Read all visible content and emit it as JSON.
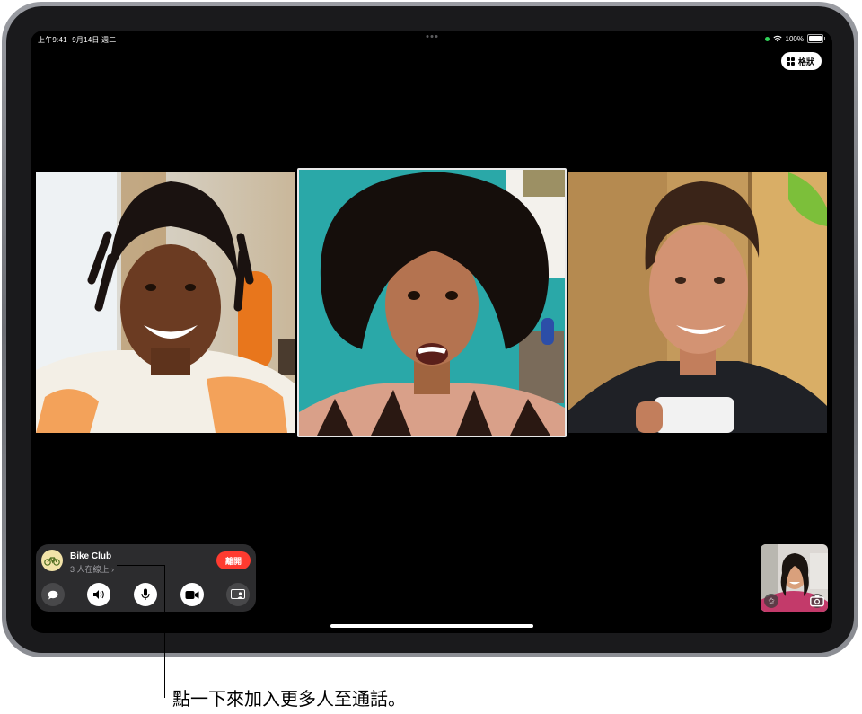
{
  "status_bar": {
    "time": "上午9:41",
    "date": "9月14日 週二",
    "battery": "100%"
  },
  "layout_button": {
    "label": "格狀"
  },
  "call": {
    "group_name": "Bike Club",
    "online_count": "3 人在線上",
    "leave_label": "離開"
  },
  "callout": {
    "text": "點一下來加入更多人至通話。"
  },
  "colors": {
    "leave": "#ff3b30",
    "panel": "#2c2c2e"
  }
}
